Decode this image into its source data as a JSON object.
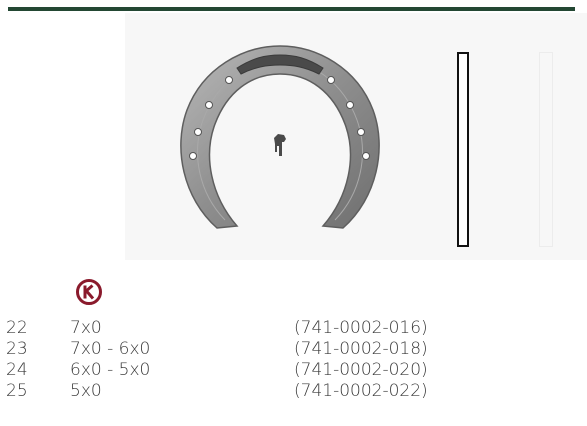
{
  "header": {
    "accent_color": "#234733"
  },
  "product": {
    "image_icon": "horseshoe-image",
    "profile_icon": "side-profile-outline",
    "logo_icon": "circled-k-logo",
    "logo_color": "#8a1a2c"
  },
  "sizes": [
    {
      "size": "22",
      "nail": "7x0",
      "part": "(741-0002-016)"
    },
    {
      "size": "23",
      "nail": "7x0 - 6x0",
      "part": "(741-0002-018)"
    },
    {
      "size": "24",
      "nail": "6x0 - 5x0",
      "part": "(741-0002-020)"
    },
    {
      "size": "25",
      "nail": "5x0",
      "part": "(741-0002-022)"
    }
  ]
}
